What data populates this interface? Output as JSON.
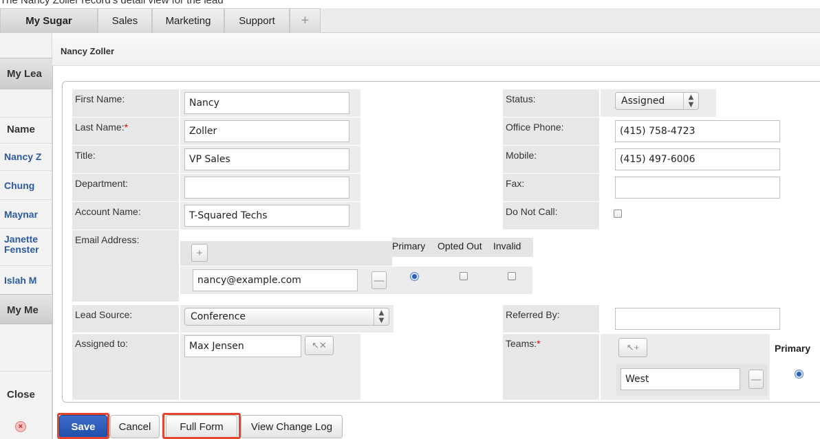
{
  "top_text": "The Nancy Zoller record's detail view for the lead",
  "tabs": [
    {
      "label": "My Sugar",
      "active": true
    },
    {
      "label": "Sales"
    },
    {
      "label": "Marketing"
    },
    {
      "label": "Support"
    },
    {
      "label": "+"
    }
  ],
  "background": {
    "dashlet1_title": "My Lea",
    "name_header": "Name",
    "rows": [
      "Nancy Z",
      "Chung",
      "Maynar",
      "Janette",
      "Fenster",
      "Islah M"
    ],
    "dashlet2_title": "My Me",
    "close_label": "Close"
  },
  "modal": {
    "title": "Nancy Zoller"
  },
  "form": {
    "first_name": {
      "label": "First Name:",
      "value": "Nancy"
    },
    "last_name": {
      "label": "Last Name:",
      "required": "*",
      "value": "Zoller"
    },
    "title": {
      "label": "Title:",
      "value": "VP Sales"
    },
    "department": {
      "label": "Department:",
      "value": ""
    },
    "account_name": {
      "label": "Account Name:",
      "value": "T-Squared Techs"
    },
    "email": {
      "label": "Email Address:",
      "col_primary": "Primary",
      "col_opted_out": "Opted Out",
      "col_invalid": "Invalid",
      "value": "nancy@example.com"
    },
    "lead_source": {
      "label": "Lead Source:",
      "value": "Conference"
    },
    "assigned_to": {
      "label": "Assigned to:",
      "value": "Max Jensen"
    },
    "status": {
      "label": "Status:",
      "value": "Assigned"
    },
    "office_phone": {
      "label": "Office Phone:",
      "value": "(415) 758-4723"
    },
    "mobile": {
      "label": "Mobile:",
      "value": "(415) 497-6006"
    },
    "fax": {
      "label": "Fax:",
      "value": ""
    },
    "do_not_call": {
      "label": "Do Not Call:"
    },
    "referred_by": {
      "label": "Referred By:",
      "value": ""
    },
    "teams": {
      "label": "Teams:",
      "required": "*",
      "value": "West",
      "col_primary": "Primary"
    }
  },
  "buttons": {
    "save": "Save",
    "cancel": "Cancel",
    "full_form": "Full Form",
    "view_change_log": "View Change Log"
  },
  "colors": {
    "link": "#2c5aa0",
    "primary_button": "#2f5fbe",
    "highlight": "#e5442f",
    "required": "#dd0000"
  }
}
